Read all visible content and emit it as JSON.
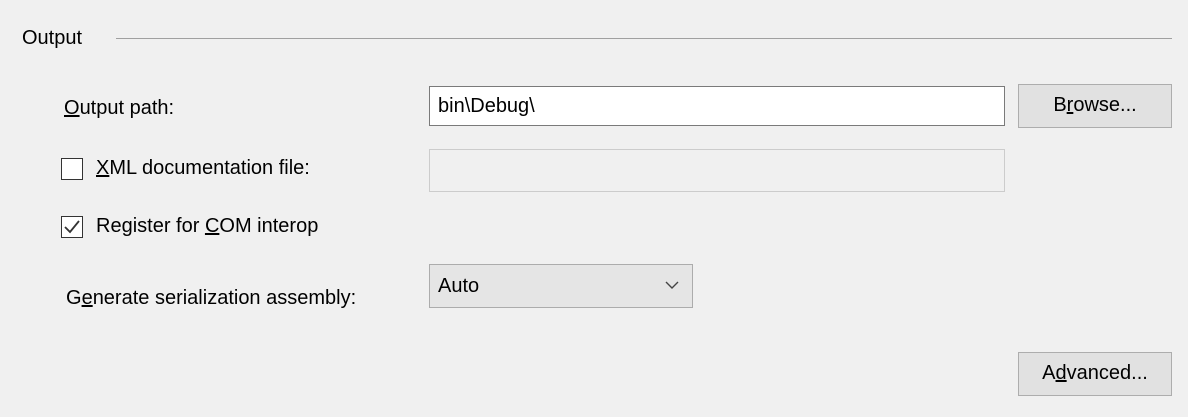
{
  "group": {
    "title": "Output"
  },
  "output_path": {
    "label_mnemonic": "O",
    "label_rest": "utput path:",
    "value": "bin\\Debug\\",
    "browse_mnemonic_pre": "B",
    "browse_mnemonic": "r",
    "browse_rest": "owse..."
  },
  "xml_doc": {
    "checked": false,
    "label_mnemonic": "X",
    "label_rest": "ML documentation file:",
    "value": ""
  },
  "com_interop": {
    "checked": true,
    "label_pre": "Register for ",
    "label_mnemonic": "C",
    "label_rest": "OM interop"
  },
  "serialization": {
    "label_pre": "G",
    "label_mnemonic": "e",
    "label_rest": "nerate serialization assembly:",
    "selected": "Auto"
  },
  "advanced": {
    "label_pre": "A",
    "label_mnemonic": "d",
    "label_rest": "vanced..."
  },
  "icons": {
    "checkmark": "check-icon",
    "dropdown": "chevron-down-icon"
  }
}
